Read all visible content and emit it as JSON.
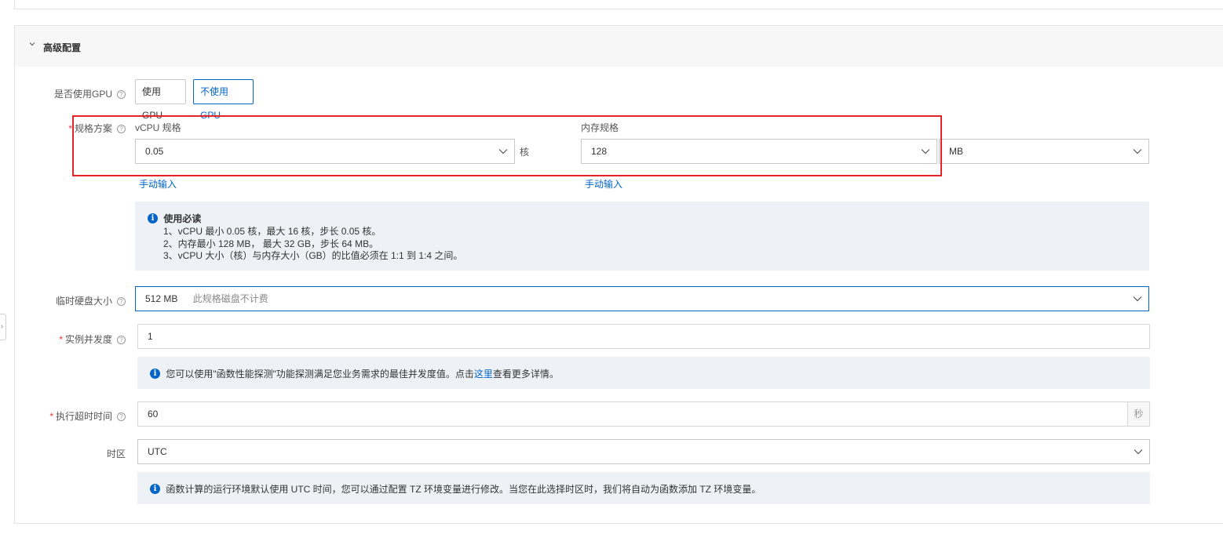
{
  "section": {
    "title": "高级配置"
  },
  "gpu": {
    "label": "是否使用GPU",
    "options": [
      "使用GPU",
      "不使用GPU"
    ],
    "selected": "不使用GPU"
  },
  "spec": {
    "label": "规格方案",
    "vcpu": {
      "label": "vCPU 规格",
      "value": "0.05",
      "unit": "核",
      "manual_link": "手动输入"
    },
    "memory": {
      "label": "内存规格",
      "value": "128",
      "unit": "MB",
      "manual_link": "手动输入"
    },
    "notice": {
      "title": "使用必读",
      "lines": [
        "1、vCPU 最小 0.05 核，最大 16 核，步长 0.05 核。",
        "2、内存最小 128 MB， 最大 32 GB，步长 64 MB。",
        "3、vCPU 大小（核）与内存大小（GB）的比值必须在 1:1 到 1:4 之间。"
      ]
    }
  },
  "disk": {
    "label": "临时硬盘大小",
    "value": "512 MB",
    "hint": "此规格磁盘不计费"
  },
  "concurrency": {
    "label": "实例并发度",
    "value": "1",
    "notice_prefix": "您可以使用\"函数性能探测\"功能探测满足您业务需求的最佳并发度值。点击",
    "notice_link": "这里",
    "notice_suffix": "查看更多详情。"
  },
  "timeout": {
    "label": "执行超时时间",
    "value": "60",
    "unit": "秒"
  },
  "timezone": {
    "label": "时区",
    "value": "UTC",
    "notice": "函数计算的运行环境默认使用 UTC 时间，您可以通过配置 TZ 环境变量进行修改。当您在此选择时区时，我们将自动为函数添加 TZ 环境变量。"
  },
  "colors": {
    "primary": "#0064c8",
    "highlight": "#e3252a",
    "required": "#e33333"
  }
}
